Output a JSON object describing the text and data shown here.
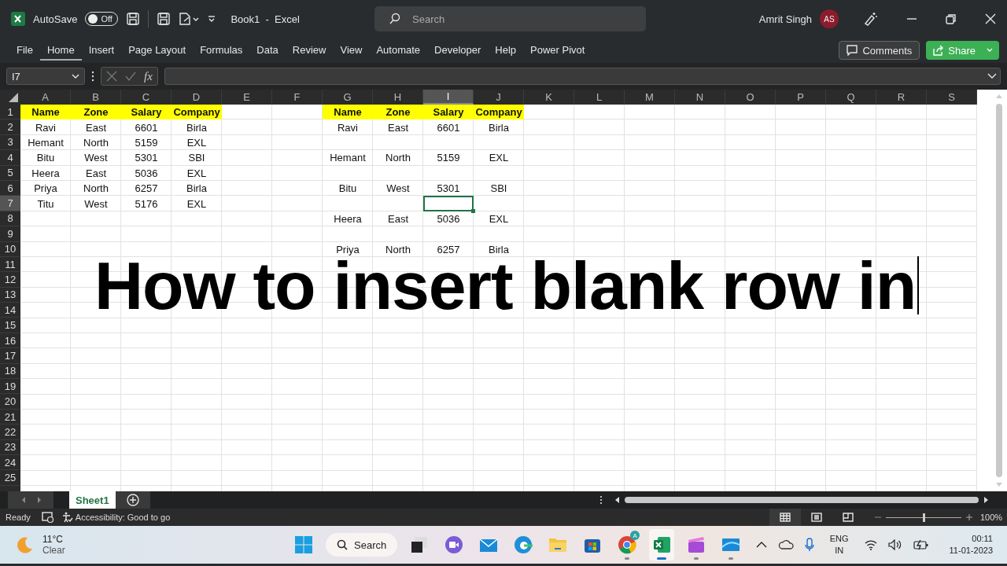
{
  "title_bar": {
    "autosave_label": "AutoSave",
    "autosave_toggle": {
      "on": false,
      "label": "Off"
    },
    "document_title": "Book1  -  Excel",
    "search": {
      "placeholder": "Search"
    },
    "user_name": "Amrit Singh",
    "avatar_initials": "AS"
  },
  "ribbon": {
    "tabs": [
      {
        "label": "File",
        "selected": false
      },
      {
        "label": "Home",
        "selected": true
      },
      {
        "label": "Insert",
        "selected": false
      },
      {
        "label": "Page Layout",
        "selected": false
      },
      {
        "label": "Formulas",
        "selected": false
      },
      {
        "label": "Data",
        "selected": false
      },
      {
        "label": "Review",
        "selected": false
      },
      {
        "label": "View",
        "selected": false
      },
      {
        "label": "Automate",
        "selected": false
      },
      {
        "label": "Developer",
        "selected": false
      },
      {
        "label": "Help",
        "selected": false
      },
      {
        "label": "Power Pivot",
        "selected": false
      }
    ],
    "comments_button": "Comments",
    "share_button": "Share"
  },
  "formula_bar": {
    "name_box": "I7",
    "function_label": "fx"
  },
  "sheet": {
    "columns": [
      {
        "label": "A",
        "selected": false
      },
      {
        "label": "B",
        "selected": false
      },
      {
        "label": "C",
        "selected": false
      },
      {
        "label": "D",
        "selected": false
      },
      {
        "label": "E",
        "selected": false
      },
      {
        "label": "F",
        "selected": false
      },
      {
        "label": "G",
        "selected": false
      },
      {
        "label": "H",
        "selected": false
      },
      {
        "label": "I",
        "selected": true
      },
      {
        "label": "J",
        "selected": false
      },
      {
        "label": "K",
        "selected": false
      },
      {
        "label": "L",
        "selected": false
      },
      {
        "label": "M",
        "selected": false
      },
      {
        "label": "N",
        "selected": false
      },
      {
        "label": "O",
        "selected": false
      },
      {
        "label": "P",
        "selected": false
      },
      {
        "label": "Q",
        "selected": false
      },
      {
        "label": "R",
        "selected": false
      },
      {
        "label": "S",
        "selected": false
      }
    ],
    "rows": [
      {
        "label": "1",
        "selected": false
      },
      {
        "label": "2",
        "selected": false
      },
      {
        "label": "3",
        "selected": false
      },
      {
        "label": "4",
        "selected": false
      },
      {
        "label": "5",
        "selected": false
      },
      {
        "label": "6",
        "selected": false
      },
      {
        "label": "7",
        "selected": true
      },
      {
        "label": "8",
        "selected": false
      },
      {
        "label": "9",
        "selected": false
      },
      {
        "label": "10",
        "selected": false
      },
      {
        "label": "11",
        "selected": false
      },
      {
        "label": "12",
        "selected": false
      },
      {
        "label": "13",
        "selected": false
      },
      {
        "label": "14",
        "selected": false
      },
      {
        "label": "15",
        "selected": false
      },
      {
        "label": "16",
        "selected": false
      },
      {
        "label": "17",
        "selected": false
      },
      {
        "label": "18",
        "selected": false
      },
      {
        "label": "19",
        "selected": false
      },
      {
        "label": "20",
        "selected": false
      },
      {
        "label": "21",
        "selected": false
      },
      {
        "label": "22",
        "selected": false
      },
      {
        "label": "23",
        "selected": false
      },
      {
        "label": "24",
        "selected": false
      },
      {
        "label": "25",
        "selected": false
      }
    ],
    "left_table": {
      "header": [
        "Name",
        "Zone",
        "Salary",
        "Company"
      ],
      "rows": [
        [
          "Ravi",
          "East",
          "6601",
          "Birla"
        ],
        [
          "Hemant",
          "North",
          "5159",
          "EXL"
        ],
        [
          "Bitu",
          "West",
          "5301",
          "SBI"
        ],
        [
          "Heera",
          "East",
          "5036",
          "EXL"
        ],
        [
          "Priya",
          "North",
          "6257",
          "Birla"
        ],
        [
          "Titu",
          "West",
          "5176",
          "EXL"
        ]
      ]
    },
    "right_table": {
      "header": [
        "Name",
        "Zone",
        "Salary",
        "Company"
      ],
      "rows": [
        {
          "kind": "data",
          "cells": [
            "Ravi",
            "East",
            "6601",
            "Birla"
          ]
        },
        {
          "kind": "blank"
        },
        {
          "kind": "data",
          "cells": [
            "Hemant",
            "North",
            "5159",
            "EXL"
          ]
        },
        {
          "kind": "blank"
        },
        {
          "kind": "data",
          "cells": [
            "Bitu",
            "West",
            "5301",
            "SBI"
          ]
        },
        {
          "kind": "blank"
        },
        {
          "kind": "data",
          "cells": [
            "Heera",
            "East",
            "5036",
            "EXL"
          ]
        },
        {
          "kind": "blank"
        },
        {
          "kind": "data",
          "cells": [
            "Priya",
            "North",
            "6257",
            "Birla"
          ]
        }
      ]
    }
  },
  "overlay_caption": "How to insert blank row in",
  "sheet_tabs": [
    {
      "label": "Sheet1",
      "selected": true
    }
  ],
  "status_bar": {
    "status": "Ready",
    "accessibility": "Accessibility: Good to go",
    "zoom": {
      "level": 0.5,
      "reading": "100%"
    }
  },
  "taskbar": {
    "weather": {
      "temperature": "11°C",
      "condition": "Clear"
    },
    "search_label": "Search",
    "apps": [
      {
        "kind": "taskview",
        "running": false,
        "active": false
      },
      {
        "kind": "chat",
        "running": false,
        "active": false
      },
      {
        "kind": "mail",
        "running": false,
        "active": false
      },
      {
        "kind": "browser",
        "running": false,
        "active": false
      },
      {
        "kind": "folder",
        "running": false,
        "active": false
      },
      {
        "kind": "store",
        "running": false,
        "active": false
      },
      {
        "kind": "chrome",
        "running": true,
        "active": false,
        "badge": "A"
      },
      {
        "kind": "excel",
        "running": true,
        "active": true
      },
      {
        "kind": "video",
        "running": true,
        "active": false
      },
      {
        "kind": "desktop",
        "running": true,
        "active": false
      }
    ],
    "language": "ENG",
    "region": "IN",
    "time": "00:11",
    "date": "11-01-2023"
  }
}
